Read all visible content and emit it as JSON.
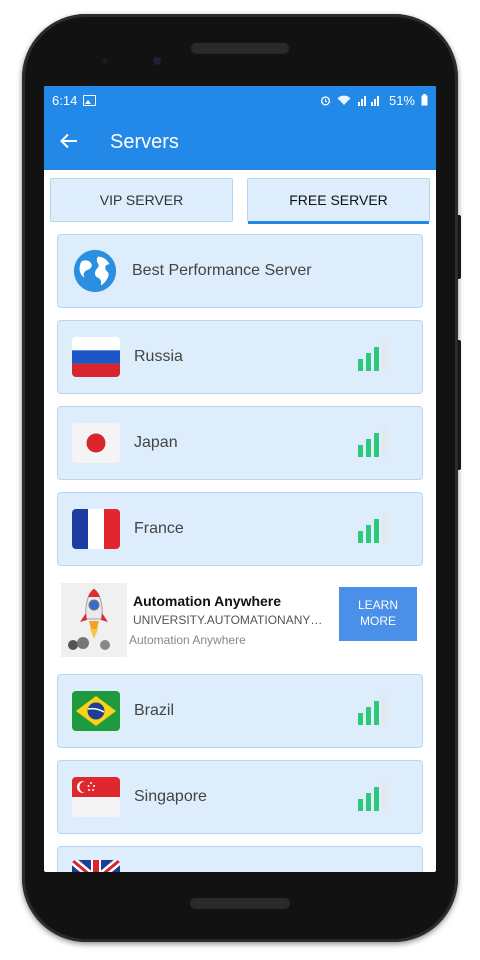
{
  "status_bar": {
    "time": "6:14",
    "battery": "51%",
    "signal_text": "☷∶∶"
  },
  "app_bar": {
    "title": "Servers",
    "back_icon": "arrow-back-icon"
  },
  "tabs": [
    {
      "label": "VIP SERVER",
      "active": false
    },
    {
      "label": "FREE SERVER",
      "active": true
    }
  ],
  "servers": [
    {
      "name": "Best Performance Server",
      "icon": "globe-icon",
      "has_signal": false
    },
    {
      "name": "Russia",
      "icon": "russia-flag-icon",
      "has_signal": true
    },
    {
      "name": "Japan",
      "icon": "japan-flag-icon",
      "has_signal": true
    },
    {
      "name": "France",
      "icon": "france-flag-icon",
      "has_signal": true
    },
    {
      "name": "Brazil",
      "icon": "brazil-flag-icon",
      "has_signal": true
    },
    {
      "name": "Singapore",
      "icon": "singapore-flag-icon",
      "has_signal": true
    }
  ],
  "ad": {
    "title": "Automation Anywhere",
    "url": "UNIVERSITY.AUTOMATIONANYWHE...",
    "advertiser": "Automation Anywhere",
    "cta": "LEARN MORE"
  },
  "colors": {
    "accent": "#2389e8",
    "card_bg": "#ddedfb",
    "card_border": "#b7d5f1",
    "signal": "#2ec87a"
  }
}
